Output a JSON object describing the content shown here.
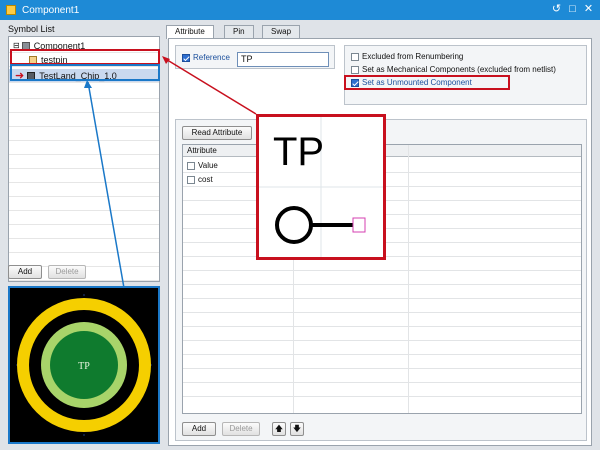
{
  "window": {
    "title": "Component1"
  },
  "symbol_list": {
    "label": "Symbol List",
    "items": [
      {
        "label": "Component1",
        "icon": "component-icon"
      },
      {
        "label": "testpin",
        "icon": "pin-symbol-icon"
      },
      {
        "label": "TestLand_Chip_1.0",
        "icon": "chip-icon",
        "selected": true
      }
    ],
    "add_label": "Add",
    "delete_label": "Delete"
  },
  "tabs": [
    "Attribute",
    "Pin",
    "Swap"
  ],
  "reference": {
    "label": "Reference",
    "checked": true,
    "value": "TP"
  },
  "options": [
    {
      "label": "Excluded from Renumbering",
      "checked": false
    },
    {
      "label": "Set as Mechanical Components (excluded from netlist)",
      "checked": false
    },
    {
      "label": "Set as Unmounted Component",
      "checked": true
    }
  ],
  "attributes": {
    "read_button": "Read Attribute",
    "column_header": "Attribute",
    "rows": [
      {
        "label": "Value",
        "checked": false
      },
      {
        "label": "cost",
        "checked": false
      }
    ],
    "add_label": "Add",
    "delete_label": "Delete"
  },
  "callout": {
    "symbol_text": "TP"
  },
  "colors": {
    "titlebar": "#1e8ad6",
    "annotation_red": "#c8101e",
    "annotation_blue": "#1a78c8"
  }
}
